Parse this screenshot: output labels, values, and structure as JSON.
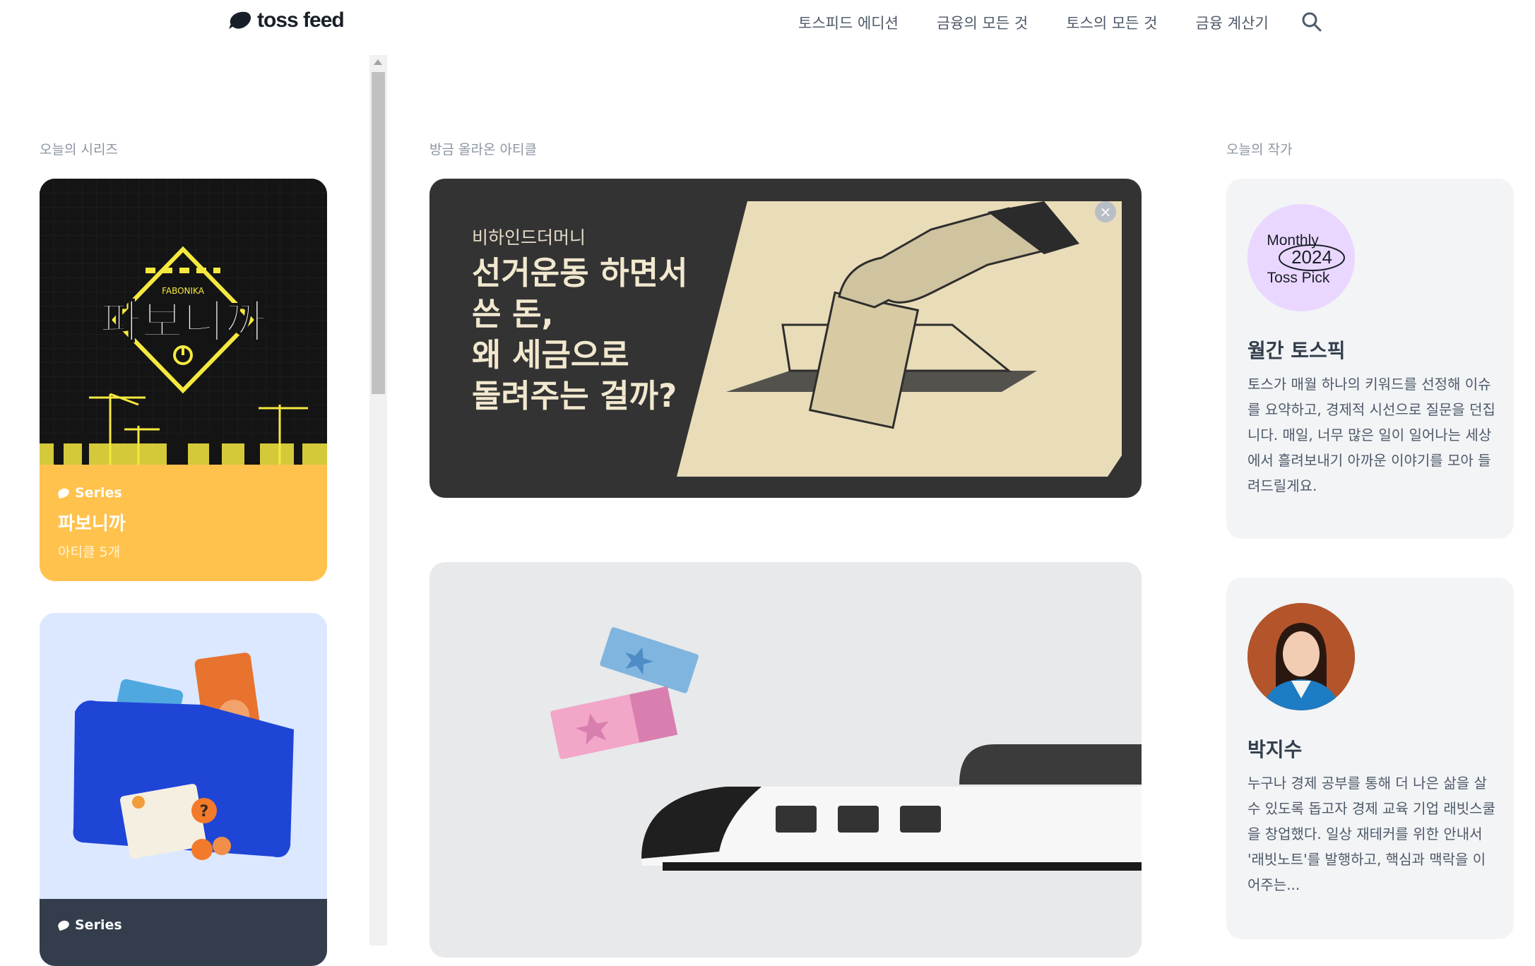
{
  "header": {
    "logo_text": "toss feed",
    "nav": [
      "토스피드 에디션",
      "금융의 모든 것",
      "토스의 모든 것",
      "금융 계산기"
    ]
  },
  "sections": {
    "series_label": "오늘의 시리즈",
    "latest_label": "방금 올라온 아티클",
    "authors_label": "오늘의 작가"
  },
  "series": [
    {
      "badge": "Series",
      "art_text": "파보니까",
      "art_subtext": "FABONIKA",
      "title": "파보니까",
      "count": "아티클 5개"
    },
    {
      "badge": "Series",
      "title": ""
    }
  ],
  "articles": [
    {
      "kicker": "비하인드더머니",
      "title_lines": [
        "선거운동 하면서",
        "쓴 돈,",
        "왜 세금으로",
        "돌려주는 걸까?"
      ],
      "close_label": "×"
    },
    {
      "kicker": "",
      "title_lines": []
    }
  ],
  "authors": [
    {
      "avatar_line1": "Monthly",
      "avatar_line2": "2024",
      "avatar_line3": "Toss Pick",
      "name": "월간 토스픽",
      "desc": "토스가 매월 하나의 키워드를 선정해 이슈를 요약하고, 경제적 시선으로 질문을 던집니다. 매일, 너무 많은 일이 일어나는 세상에서 흘려보내기 아까운 이야기를 모아 들려드릴게요."
    },
    {
      "name": "박지수",
      "desc": "누구나 경제 공부를 통해 더 나은 삶을 살 수 있도록 돕고자 경제 교육 기업 래빗스쿨을 창업했다. 일상 재테커를 위한 안내서 '래빗노트'를 발행하고, 핵심과 맥락을 이어주는..."
    }
  ],
  "colors": {
    "series1_bg": "#ffc24d",
    "series2_info_bg": "#333d4b",
    "hero_bg": "#333333",
    "author_card_bg": "#f2f4f6",
    "accent_yellow": "#f5e940"
  },
  "icons": [
    "logo-icon",
    "search-icon",
    "close-icon",
    "series-icon"
  ]
}
